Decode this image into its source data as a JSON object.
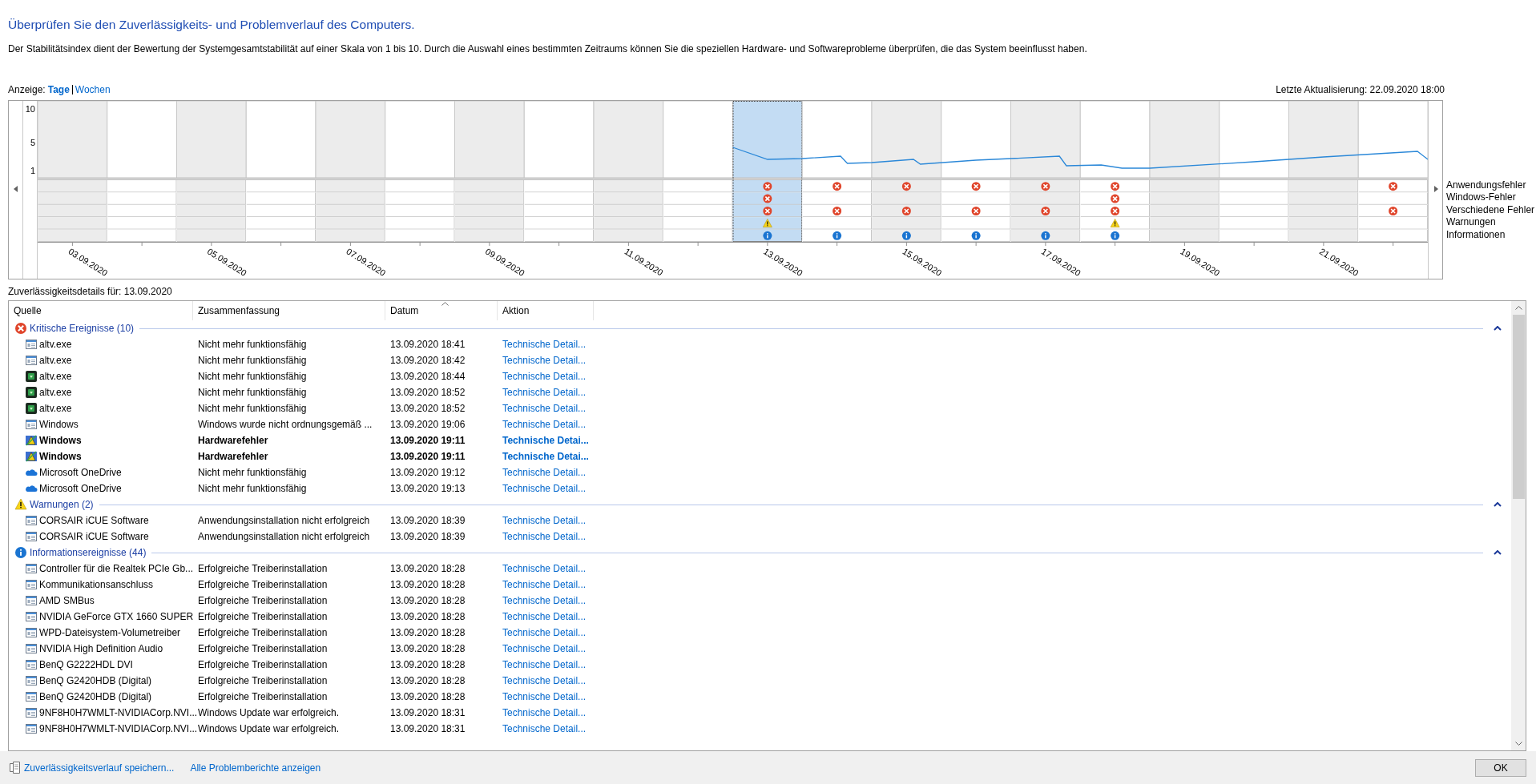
{
  "heading": "Überprüfen Sie den Zuverlässigkeits- und Problemverlauf des Computers.",
  "description": "Der Stabilitätsindex dient der Bewertung der Systemgesamtstabilität auf einer Skala von 1 bis 10. Durch die Auswahl eines bestimmten Zeitraums können Sie die speziellen Hardware- und Softwareprobleme überprüfen, die das System beeinflusst haben.",
  "view": {
    "label": "Anzeige:",
    "options": [
      {
        "label": "Tage",
        "selected": true
      },
      {
        "label": "Wochen",
        "selected": false
      }
    ]
  },
  "last_update": "Letzte Aktualisierung: 22.09.2020 18:00",
  "chart": {
    "scale_labels": [
      "10",
      "5",
      "1"
    ],
    "date_labels": [
      "03.09.2020",
      "05.09.2020",
      "07.09.2020",
      "09.09.2020",
      "11.09.2020",
      "13.09.2020",
      "15.09.2020",
      "17.09.2020",
      "19.09.2020",
      "21.09.2020"
    ],
    "days": [
      {
        "selected": false
      },
      {
        "selected": false
      },
      {
        "selected": false
      },
      {
        "selected": false
      },
      {
        "selected": false
      },
      {
        "selected": false
      },
      {
        "selected": false
      },
      {
        "selected": false
      },
      {
        "selected": false
      },
      {
        "selected": false
      },
      {
        "selected": true
      },
      {
        "selected": false
      },
      {
        "selected": false
      },
      {
        "selected": false
      },
      {
        "selected": false
      },
      {
        "selected": false
      },
      {
        "selected": false
      },
      {
        "selected": false
      },
      {
        "selected": false
      },
      {
        "selected": false
      }
    ],
    "event_rows": [
      {
        "label": "Anwendungsfehler",
        "kind": "error",
        "marks": [
          false,
          false,
          false,
          false,
          false,
          false,
          false,
          false,
          false,
          false,
          true,
          true,
          true,
          true,
          true,
          true,
          false,
          false,
          false,
          true
        ]
      },
      {
        "label": "Windows-Fehler",
        "kind": "error",
        "marks": [
          false,
          false,
          false,
          false,
          false,
          false,
          false,
          false,
          false,
          false,
          true,
          false,
          false,
          false,
          false,
          true,
          false,
          false,
          false,
          false
        ]
      },
      {
        "label": "Verschiedene Fehler",
        "kind": "error",
        "marks": [
          false,
          false,
          false,
          false,
          false,
          false,
          false,
          false,
          false,
          false,
          true,
          true,
          true,
          true,
          true,
          true,
          false,
          false,
          false,
          true
        ]
      },
      {
        "label": "Warnungen",
        "kind": "warning",
        "marks": [
          false,
          false,
          false,
          false,
          false,
          false,
          false,
          false,
          false,
          false,
          true,
          false,
          false,
          false,
          false,
          true,
          false,
          false,
          false,
          false
        ]
      },
      {
        "label": "Informationen",
        "kind": "info",
        "marks": [
          false,
          false,
          false,
          false,
          false,
          false,
          false,
          false,
          false,
          false,
          true,
          true,
          true,
          true,
          true,
          true,
          false,
          false,
          false,
          false
        ]
      }
    ]
  },
  "details_label": "Zuverlässigkeitsdetails für: 13.09.2020",
  "table": {
    "columns": [
      {
        "label": "Quelle",
        "sorted": false
      },
      {
        "label": "Zusammenfassung",
        "sorted": false
      },
      {
        "label": "Datum",
        "sorted": true
      },
      {
        "label": "Aktion",
        "sorted": false
      }
    ],
    "groups": [
      {
        "kind": "error",
        "title": "Kritische Ereignisse (10)",
        "expanded": true,
        "rows": [
          {
            "kind": "window",
            "source": "altv.exe",
            "summary": "Nicht mehr funktionsfähig",
            "date": "13.09.2020 18:41",
            "action": "Technische Detail...",
            "bold": false
          },
          {
            "kind": "window",
            "source": "altv.exe",
            "summary": "Nicht mehr funktionsfähig",
            "date": "13.09.2020 18:42",
            "action": "Technische Detail...",
            "bold": false
          },
          {
            "kind": "green",
            "source": "altv.exe",
            "summary": "Nicht mehr funktionsfähig",
            "date": "13.09.2020 18:44",
            "action": "Technische Detail...",
            "bold": false
          },
          {
            "kind": "green",
            "source": "altv.exe",
            "summary": "Nicht mehr funktionsfähig",
            "date": "13.09.2020 18:52",
            "action": "Technische Detail...",
            "bold": false
          },
          {
            "kind": "green",
            "source": "altv.exe",
            "summary": "Nicht mehr funktionsfähig",
            "date": "13.09.2020 18:52",
            "action": "Technische Detail...",
            "bold": false
          },
          {
            "kind": "window",
            "source": "Windows",
            "summary": "Windows wurde nicht ordnungsgemäß ...",
            "date": "13.09.2020 19:06",
            "action": "Technische Detail...",
            "bold": false
          },
          {
            "kind": "shield",
            "source": "Windows",
            "summary": "Hardwarefehler",
            "date": "13.09.2020 19:11",
            "action": "Technische Detai...",
            "bold": true
          },
          {
            "kind": "shield",
            "source": "Windows",
            "summary": "Hardwarefehler",
            "date": "13.09.2020 19:11",
            "action": "Technische Detai...",
            "bold": true
          },
          {
            "kind": "cloud",
            "source": "Microsoft OneDrive",
            "summary": "Nicht mehr funktionsfähig",
            "date": "13.09.2020 19:12",
            "action": "Technische Detail...",
            "bold": false
          },
          {
            "kind": "cloud",
            "source": "Microsoft OneDrive",
            "summary": "Nicht mehr funktionsfähig",
            "date": "13.09.2020 19:13",
            "action": "Technische Detail...",
            "bold": false
          }
        ]
      },
      {
        "kind": "warning",
        "title": "Warnungen (2)",
        "expanded": true,
        "rows": [
          {
            "kind": "window",
            "source": "CORSAIR iCUE Software",
            "summary": "Anwendungsinstallation nicht erfolgreich",
            "date": "13.09.2020 18:39",
            "action": "Technische Detail...",
            "bold": false
          },
          {
            "kind": "window",
            "source": "CORSAIR iCUE Software",
            "summary": "Anwendungsinstallation nicht erfolgreich",
            "date": "13.09.2020 18:39",
            "action": "Technische Detail...",
            "bold": false
          }
        ]
      },
      {
        "kind": "info",
        "title": "Informationsereignisse (44)",
        "expanded": true,
        "rows": [
          {
            "kind": "window",
            "source": "Controller für die Realtek PCIe Gb...",
            "summary": "Erfolgreiche Treiberinstallation",
            "date": "13.09.2020 18:28",
            "action": "Technische Detail...",
            "bold": false
          },
          {
            "kind": "window",
            "source": "Kommunikationsanschluss",
            "summary": "Erfolgreiche Treiberinstallation",
            "date": "13.09.2020 18:28",
            "action": "Technische Detail...",
            "bold": false
          },
          {
            "kind": "window",
            "source": "AMD SMBus",
            "summary": "Erfolgreiche Treiberinstallation",
            "date": "13.09.2020 18:28",
            "action": "Technische Detail...",
            "bold": false
          },
          {
            "kind": "window",
            "source": "NVIDIA GeForce GTX 1660 SUPER",
            "summary": "Erfolgreiche Treiberinstallation",
            "date": "13.09.2020 18:28",
            "action": "Technische Detail...",
            "bold": false
          },
          {
            "kind": "window",
            "source": "WPD-Dateisystem-Volumetreiber",
            "summary": "Erfolgreiche Treiberinstallation",
            "date": "13.09.2020 18:28",
            "action": "Technische Detail...",
            "bold": false
          },
          {
            "kind": "window",
            "source": "NVIDIA High Definition Audio",
            "summary": "Erfolgreiche Treiberinstallation",
            "date": "13.09.2020 18:28",
            "action": "Technische Detail...",
            "bold": false
          },
          {
            "kind": "window",
            "source": "BenQ G2222HDL DVI",
            "summary": "Erfolgreiche Treiberinstallation",
            "date": "13.09.2020 18:28",
            "action": "Technische Detail...",
            "bold": false
          },
          {
            "kind": "window",
            "source": "BenQ G2420HDB (Digital)",
            "summary": "Erfolgreiche Treiberinstallation",
            "date": "13.09.2020 18:28",
            "action": "Technische Detail...",
            "bold": false
          },
          {
            "kind": "window",
            "source": "BenQ G2420HDB (Digital)",
            "summary": "Erfolgreiche Treiberinstallation",
            "date": "13.09.2020 18:28",
            "action": "Technische Detail...",
            "bold": false
          },
          {
            "kind": "window",
            "source": "9NF8H0H7WMLT-NVIDIACorp.NVI...",
            "summary": "Windows Update war erfolgreich.",
            "date": "13.09.2020 18:31",
            "action": "Technische Detail...",
            "bold": false
          },
          {
            "kind": "window",
            "source": "9NF8H0H7WMLT-NVIDIACorp.NVI...",
            "summary": "Windows Update war erfolgreich.",
            "date": "13.09.2020 18:31",
            "action": "Technische Detail...",
            "bold": false
          }
        ]
      }
    ]
  },
  "footer": {
    "links": [
      {
        "label": "Zuverlässigkeitsverlauf speichern...",
        "kind": "save"
      },
      {
        "label": "Alle Problemberichte anzeigen",
        "kind": "plain"
      }
    ],
    "button": "OK"
  }
}
